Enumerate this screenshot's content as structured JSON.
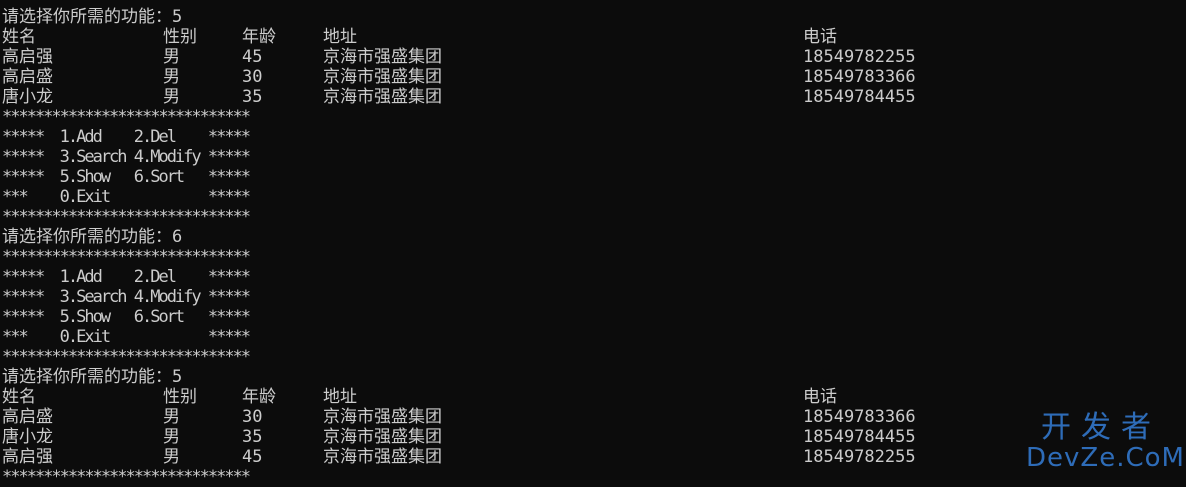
{
  "lines": [
    {
      "type": "prompt",
      "text": "请选择你所需的功能：5"
    },
    {
      "type": "header",
      "cells": [
        "姓名",
        "性别",
        "年龄",
        "地址",
        "电话"
      ]
    },
    {
      "type": "row",
      "cells": [
        "高启强",
        "男",
        "45",
        "京海市强盛集团",
        "18549782255"
      ]
    },
    {
      "type": "row",
      "cells": [
        "高启盛",
        "男",
        "30",
        "京海市强盛集团",
        "18549783366"
      ]
    },
    {
      "type": "row",
      "cells": [
        "唐小龙",
        "男",
        "35",
        "京海市强盛集团",
        "18549784455"
      ]
    },
    {
      "type": "border",
      "text": "******************************"
    },
    {
      "type": "menu",
      "text": "*****  1.Add    2.Del    *****"
    },
    {
      "type": "menu",
      "text": "*****  3.Search 4.Modify *****"
    },
    {
      "type": "menu",
      "text": "*****  5.Show   6.Sort   *****"
    },
    {
      "type": "menu",
      "text": "***    0.Exit            *****"
    },
    {
      "type": "border",
      "text": "******************************"
    },
    {
      "type": "prompt",
      "text": "请选择你所需的功能：6"
    },
    {
      "type": "border",
      "text": "******************************"
    },
    {
      "type": "menu",
      "text": "*****  1.Add    2.Del    *****"
    },
    {
      "type": "menu",
      "text": "*****  3.Search 4.Modify *****"
    },
    {
      "type": "menu",
      "text": "*****  5.Show   6.Sort   *****"
    },
    {
      "type": "menu",
      "text": "***    0.Exit            *****"
    },
    {
      "type": "border",
      "text": "******************************"
    },
    {
      "type": "prompt",
      "text": "请选择你所需的功能：5"
    },
    {
      "type": "header",
      "cells": [
        "姓名",
        "性别",
        "年龄",
        "地址",
        "电话"
      ]
    },
    {
      "type": "row",
      "cells": [
        "高启盛",
        "男",
        "30",
        "京海市强盛集团",
        "18549783366"
      ]
    },
    {
      "type": "row",
      "cells": [
        "唐小龙",
        "男",
        "35",
        "京海市强盛集团",
        "18549784455"
      ]
    },
    {
      "type": "row",
      "cells": [
        "高启强",
        "男",
        "45",
        "京海市强盛集团",
        "18549782255"
      ]
    },
    {
      "type": "border",
      "text": "******************************"
    }
  ],
  "watermark": {
    "top": "开发者",
    "bottom": "DevZe.CoM"
  }
}
